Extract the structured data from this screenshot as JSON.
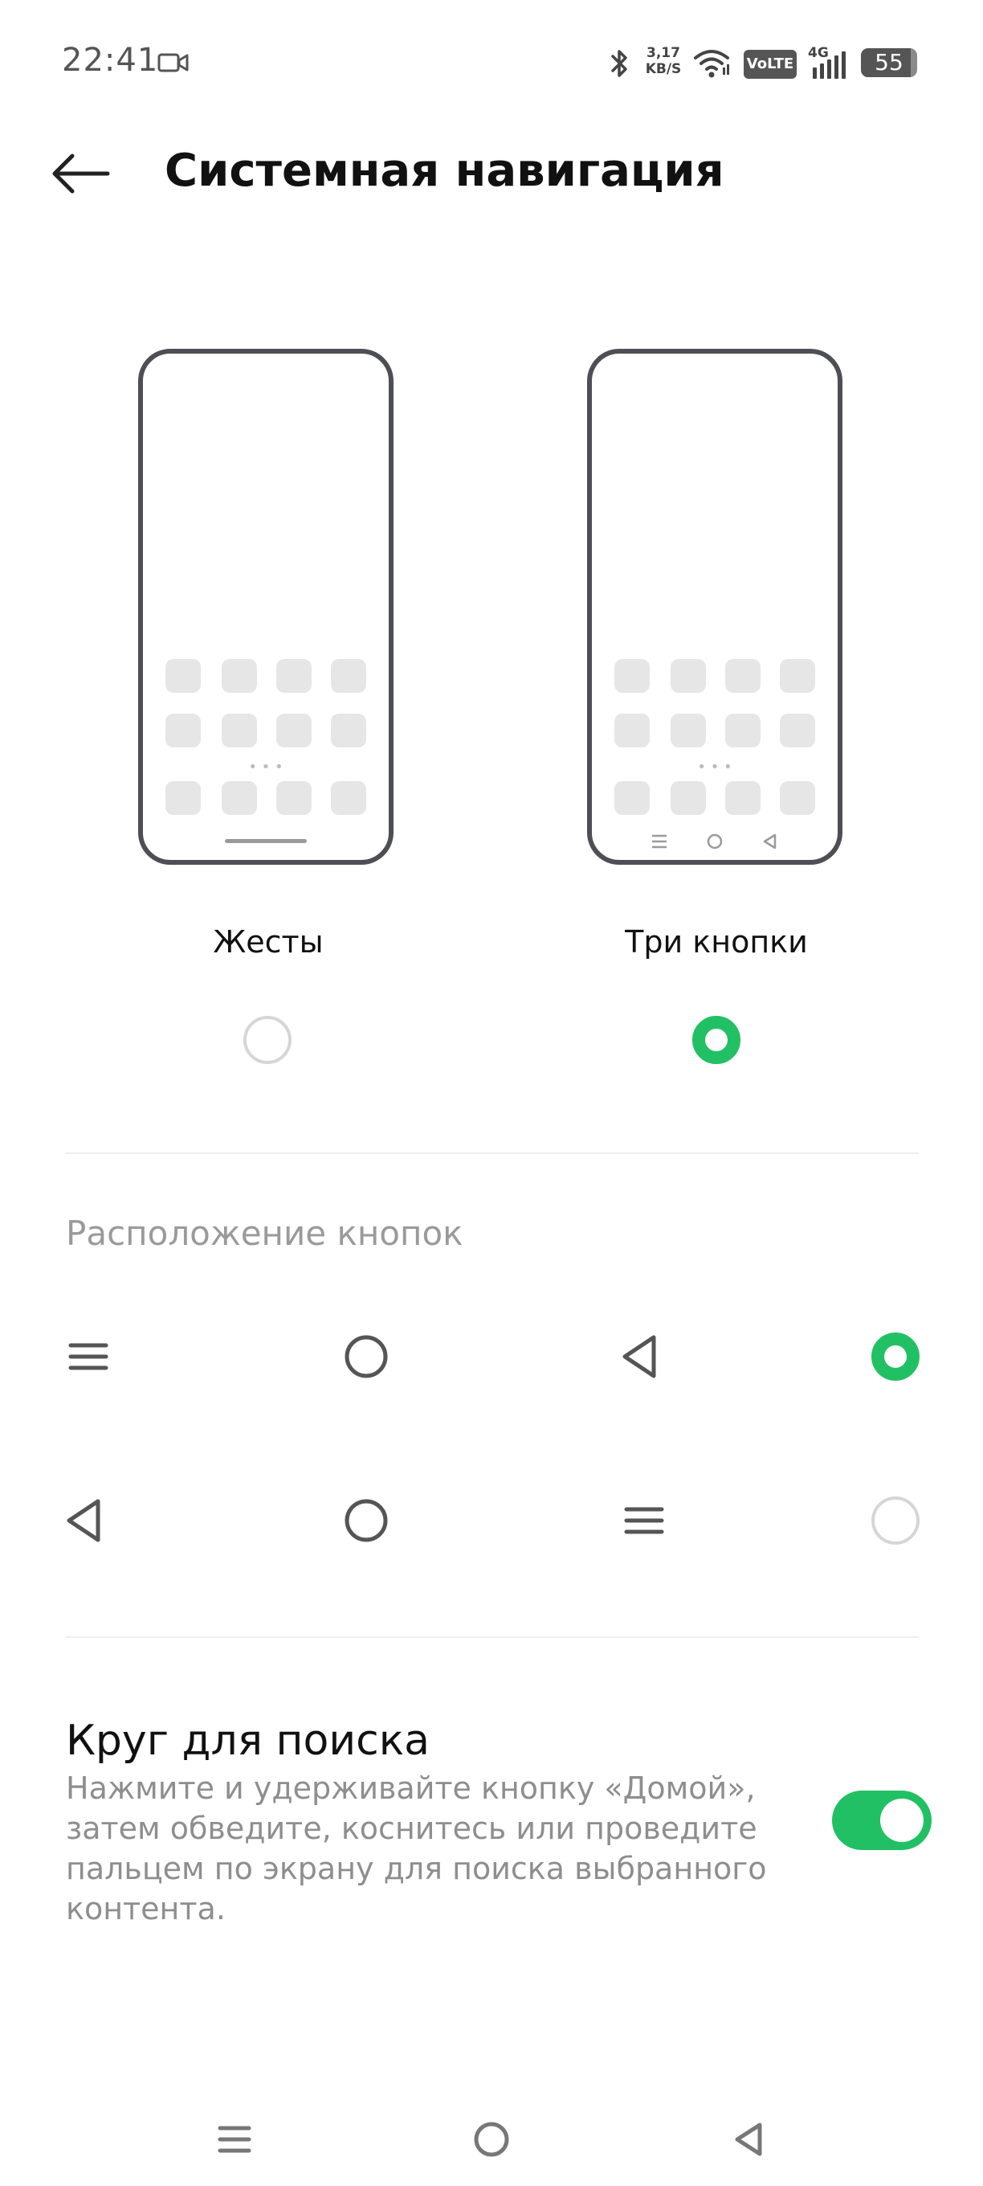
{
  "status_bar": {
    "time": "22:41",
    "speed_value": "3,17",
    "speed_unit": "KB/S",
    "volte": "VoLTE",
    "network": "4G",
    "battery": "55",
    "icons": [
      "video-camera-icon",
      "bluetooth-icon",
      "wifi-icon",
      "signal-icon",
      "battery-icon"
    ]
  },
  "header": {
    "back_icon": "arrow-left-icon",
    "title": "Системная навигация"
  },
  "navigation_modes": [
    {
      "label": "Жесты",
      "selected": false
    },
    {
      "label": "Три кнопки",
      "selected": true
    }
  ],
  "button_layout": {
    "title": "Расположение кнопок",
    "options": [
      {
        "icons": [
          "menu-icon",
          "home-circle-icon",
          "back-triangle-icon"
        ],
        "selected": true
      },
      {
        "icons": [
          "back-triangle-icon",
          "home-circle-icon",
          "menu-icon"
        ],
        "selected": false
      }
    ]
  },
  "circle_to_search": {
    "title": "Круг для поиска",
    "description": "Нажмите и удерживайте кнопку «Домой», затем обведите, коснитесь или проведите пальцем по экрану для поиска выбранного контента.",
    "enabled": true
  },
  "system_nav": {
    "icons": [
      "menu-icon",
      "home-circle-icon",
      "back-triangle-icon"
    ]
  },
  "colors": {
    "accent": "#22c064",
    "text_primary": "#111111",
    "text_secondary": "#8e8e8e",
    "radio_off": "#d6d6d6"
  }
}
